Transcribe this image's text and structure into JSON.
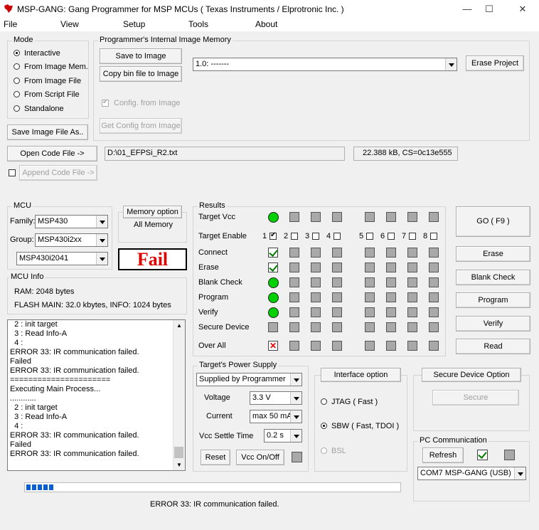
{
  "window": {
    "title": "MSP-GANG:  Gang Programmer for MSP MCUs ( Texas Instruments / Elprotronic Inc. )",
    "min": "—",
    "max": "☐",
    "close": "✕"
  },
  "menu": [
    "File",
    "View",
    "Setup",
    "Tools",
    "About"
  ],
  "mode": {
    "title": "Mode",
    "options": [
      "Interactive",
      "From Image Mem.",
      "From Image File",
      "From Script File",
      "Standalone"
    ],
    "selected": "Interactive",
    "save_image_btn": "Save Image File As.."
  },
  "image_memory": {
    "title": "Programmer's Internal Image Memory",
    "save_btn": "Save to Image",
    "copy_btn": "Copy bin file to Image",
    "slot": "1.0: -------",
    "erase_project_btn": "Erase Project",
    "config_from_image": "Config. from Image",
    "get_config_btn": "Get Config from Image"
  },
  "code": {
    "open_btn": "Open Code File ->",
    "append_btn": "Append Code File ->",
    "path": "D:\\01_EFPSi_R2.txt",
    "info": "22.388 kB, CS=0c13e555"
  },
  "mcu": {
    "title": "MCU",
    "family_label": "Family:",
    "family": "MSP430",
    "group_label": "Group:",
    "group": "MSP430i2xx",
    "device": "MSP430i2041",
    "memory_option_btn": "Memory option",
    "memory_option_value": "All Memory",
    "status": "Fail"
  },
  "mcu_info": {
    "title": "MCU Info",
    "ram": "RAM:  2048 bytes",
    "flash": "FLASH MAIN:  32.0 kbytes,  INFO: 1024 bytes"
  },
  "log": [
    "  2 : init target",
    "  3 : Read Info-A",
    "  4 :",
    "ERROR 33: IR communication failed.",
    "Failed",
    "ERROR 33: IR communication failed.",
    "======================",
    "Executing Main Process...",
    "............",
    "  2 : init target",
    "  3 : Read Info-A",
    "  4 :",
    "ERROR 33: IR communication failed.",
    "Failed",
    "ERROR 33: IR communication failed."
  ],
  "results": {
    "title": "Results",
    "rows": [
      "Target Vcc",
      "Target Enable",
      "Connect",
      "Erase",
      "Blank Check",
      "Program",
      "Verify",
      "Secure Device",
      "Over All"
    ],
    "target_numbers": [
      "1",
      "2",
      "3",
      "4",
      "5",
      "6",
      "7",
      "8"
    ],
    "col1_status": [
      "green",
      "enable",
      "ok",
      "ok",
      "green",
      "green",
      "green",
      "grey",
      "fail"
    ],
    "target_enabled": [
      true,
      false,
      false,
      false,
      false,
      false,
      false,
      false
    ]
  },
  "actions": {
    "go": "GO    ( F9 )",
    "erase": "Erase",
    "blank_check": "Blank Check",
    "program": "Program",
    "verify": "Verify",
    "read": "Read"
  },
  "power": {
    "title": "Target's Power Supply",
    "source": "Supplied by Programmer",
    "voltage_label": "Voltage",
    "voltage": "3.3 V",
    "current_label": "Current",
    "current": "max 50 mA",
    "settle_label": "Vcc Settle Time",
    "settle": "0.2 s",
    "reset_btn": "Reset",
    "vcc_btn": "Vcc On/Off"
  },
  "interface": {
    "title_btn": "Interface option",
    "options": [
      "JTAG ( Fast )",
      "SBW ( Fast, TDOI )",
      "BSL"
    ],
    "selected": "SBW ( Fast, TDOI )"
  },
  "secure": {
    "title_btn": "Secure Device Option",
    "secure_btn": "Secure"
  },
  "pc": {
    "title": "PC Communication",
    "refresh_btn": "Refresh",
    "port": "COM7   MSP-GANG (USB)"
  },
  "progress_fraction": 0.08,
  "status_text": "ERROR 33: IR communication failed."
}
